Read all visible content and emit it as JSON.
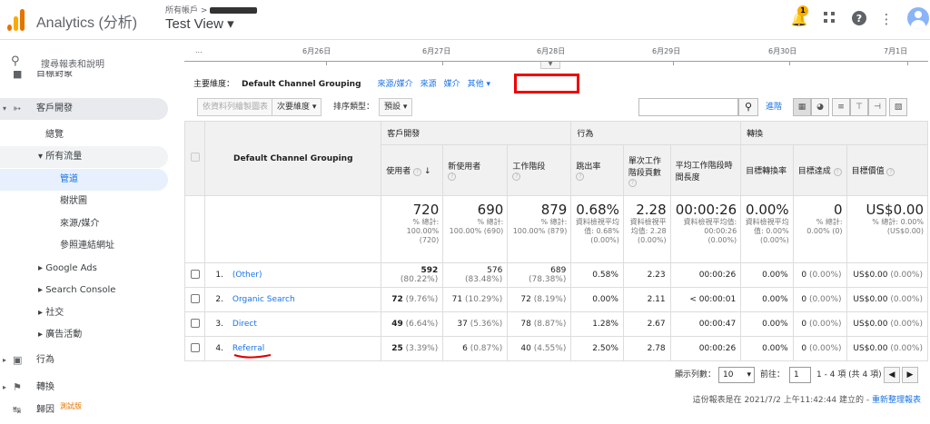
{
  "app": {
    "title": "Analytics (分析)",
    "account_path": "所有帳戶 >",
    "view_name": "Test View ▾",
    "notifications": "1"
  },
  "sidebar": {
    "search_placeholder": "搜尋報表和說明",
    "items": [
      {
        "label": "目標對象"
      },
      {
        "label": "客戶開發"
      },
      {
        "label": "總覽"
      },
      {
        "label": "▾ 所有流量"
      },
      {
        "label": "管道"
      },
      {
        "label": "樹狀圖"
      },
      {
        "label": "來源/媒介"
      },
      {
        "label": "參照連結網址"
      },
      {
        "label": "Google Ads"
      },
      {
        "label": "Search Console"
      },
      {
        "label": "社交"
      },
      {
        "label": "廣告活動"
      },
      {
        "label": "行為"
      },
      {
        "label": "轉換"
      },
      {
        "label": "歸因"
      }
    ],
    "beta": "測試版"
  },
  "timeline": {
    "dates": [
      "...",
      "6月26日",
      "6月27日",
      "6月28日",
      "6月29日",
      "6月30日",
      "7月1日"
    ]
  },
  "dimension": {
    "label": "主要維度：",
    "current": "Default Channel Grouping",
    "options": [
      "來源/媒介",
      "來源",
      "媒介",
      "其他 ▾"
    ]
  },
  "toolbar": {
    "plot_rows": "依資料列繪製圖表",
    "secondary_dim": "次要維度 ▾",
    "sort_label": "排序類型：",
    "sort_value": "預設 ▾",
    "advanced": "進階"
  },
  "table": {
    "group_headers": {
      "acquisition": "客戶開發",
      "behavior": "行為",
      "conversions": "轉換"
    },
    "dim_header": "Default Channel Grouping",
    "columns": [
      "使用者",
      "新使用者",
      "工作階段",
      "跳出率",
      "單次工作階段頁數",
      "平均工作階段時間長度",
      "目標轉換率",
      "目標達成",
      "目標價值"
    ],
    "totals": [
      {
        "value": "720",
        "sub": "% 總計: 100.00% (720)"
      },
      {
        "value": "690",
        "sub": "% 總計: 100.00% (690)"
      },
      {
        "value": "879",
        "sub": "% 總計: 100.00% (879)"
      },
      {
        "value": "0.68%",
        "sub": "資料檢視平均值: 0.68% (0.00%)"
      },
      {
        "value": "2.28",
        "sub": "資料檢視平均值: 2.28 (0.00%)"
      },
      {
        "value": "00:00:26",
        "sub": "資料檢視平均值: 00:00:26 (0.00%)"
      },
      {
        "value": "0.00%",
        "sub": "資料檢視平均值: 0.00% (0.00%)"
      },
      {
        "value": "0",
        "sub": "% 總計: 0.00% (0)"
      },
      {
        "value": "US$0.00",
        "sub": "% 總計: 0.00% (US$0.00)"
      }
    ],
    "rows": [
      {
        "idx": "1.",
        "name": "(Other)",
        "users": "592",
        "users_pct": "(80.22%)",
        "new": "576",
        "new_pct": "(83.48%)",
        "sess": "689",
        "sess_pct": "(78.38%)",
        "bounce": "0.58%",
        "pages": "2.23",
        "dur": "00:00:26",
        "conv": "0.00%",
        "goal": "0",
        "goal_pct": "(0.00%)",
        "val": "US$0.00",
        "val_pct": "(0.00%)"
      },
      {
        "idx": "2.",
        "name": "Organic Search",
        "users": "72",
        "users_pct": "(9.76%)",
        "new": "71",
        "new_pct": "(10.29%)",
        "sess": "72",
        "sess_pct": "(8.19%)",
        "bounce": "0.00%",
        "pages": "2.11",
        "dur": "< 00:00:01",
        "conv": "0.00%",
        "goal": "0",
        "goal_pct": "(0.00%)",
        "val": "US$0.00",
        "val_pct": "(0.00%)"
      },
      {
        "idx": "3.",
        "name": "Direct",
        "users": "49",
        "users_pct": "(6.64%)",
        "new": "37",
        "new_pct": "(5.36%)",
        "sess": "78",
        "sess_pct": "(8.87%)",
        "bounce": "1.28%",
        "pages": "2.67",
        "dur": "00:00:47",
        "conv": "0.00%",
        "goal": "0",
        "goal_pct": "(0.00%)",
        "val": "US$0.00",
        "val_pct": "(0.00%)"
      },
      {
        "idx": "4.",
        "name": "Referral",
        "users": "25",
        "users_pct": "(3.39%)",
        "new": "6",
        "new_pct": "(0.87%)",
        "sess": "40",
        "sess_pct": "(4.55%)",
        "bounce": "2.50%",
        "pages": "2.78",
        "dur": "00:00:26",
        "conv": "0.00%",
        "goal": "0",
        "goal_pct": "(0.00%)",
        "val": "US$0.00",
        "val_pct": "(0.00%)"
      }
    ]
  },
  "pager": {
    "rows_label": "顯示列數：",
    "rows_value": "10",
    "goto_label": "前往：",
    "goto_value": "1",
    "range": "1 - 4 項 (共 4 項)"
  },
  "footer": {
    "note": "這份報表是在 2021/7/2 上午11:42:44 建立的 - ",
    "refresh": "重新整理報表"
  },
  "colors": {
    "accent": "#1a73e8",
    "highlight": "#e00000"
  }
}
